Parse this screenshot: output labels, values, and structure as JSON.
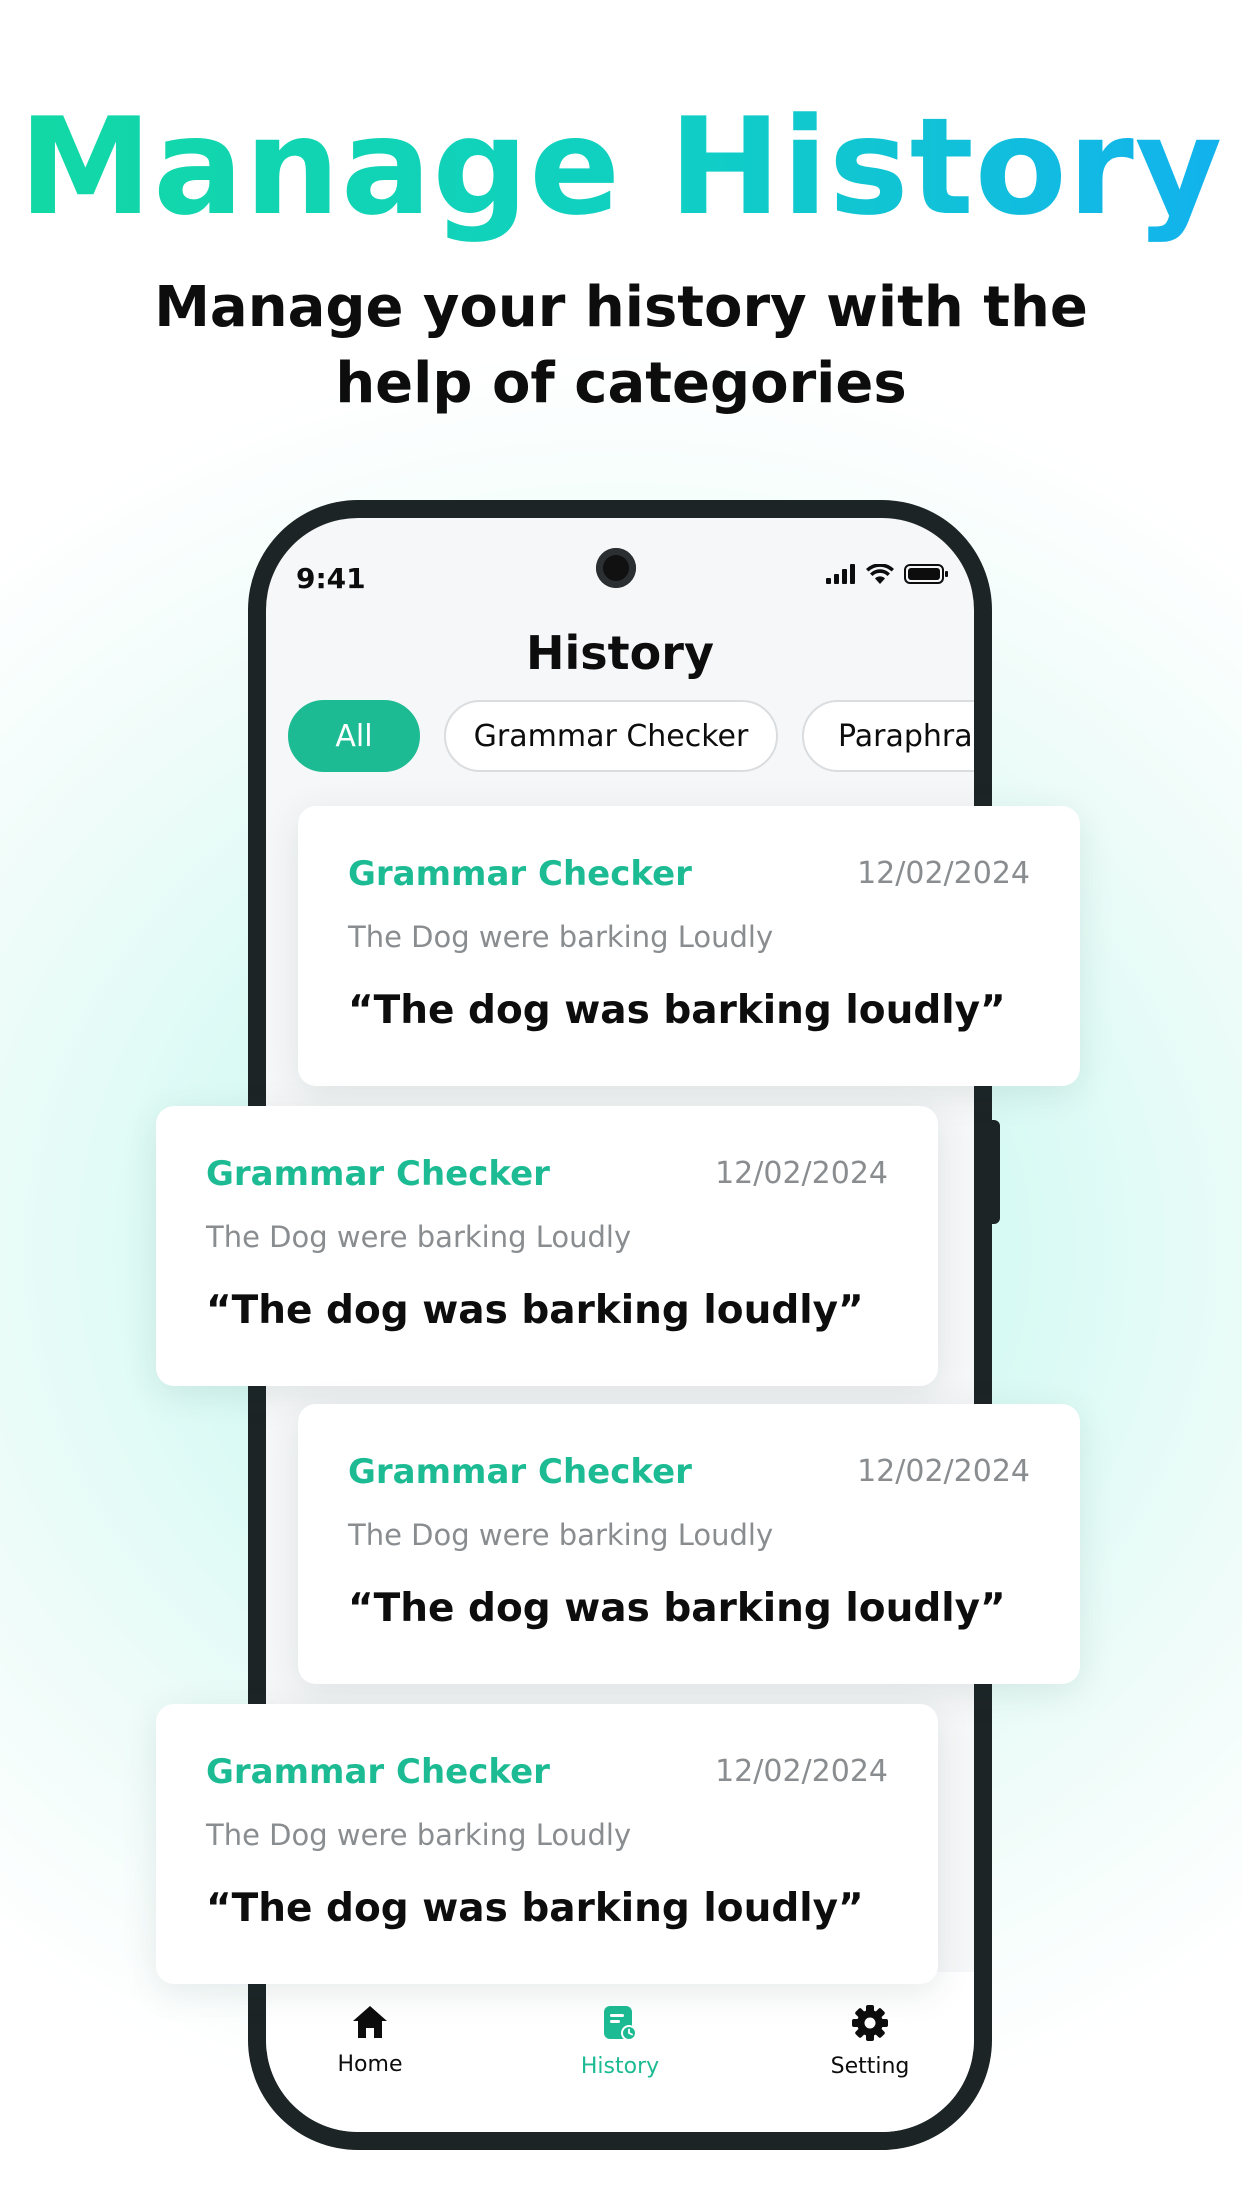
{
  "promo": {
    "headline": "Manage History",
    "subheadline": "Manage your history with the help of categories"
  },
  "status_bar": {
    "time": "9:41"
  },
  "screen": {
    "title": "History",
    "filters": [
      {
        "label": "All",
        "selected": true
      },
      {
        "label": "Grammar Checker",
        "selected": false
      },
      {
        "label": "Paraphra",
        "selected": false
      }
    ]
  },
  "history_items": [
    {
      "category": "Grammar Checker",
      "date": "12/02/2024",
      "original": "The Dog were barking Loudly",
      "corrected": "“The dog was barking loudly”"
    },
    {
      "category": "Grammar Checker",
      "date": "12/02/2024",
      "original": "The Dog were barking Loudly",
      "corrected": "“The dog was barking loudly”"
    },
    {
      "category": "Grammar Checker",
      "date": "12/02/2024",
      "original": "The Dog were barking Loudly",
      "corrected": "“The dog was barking loudly”"
    },
    {
      "category": "Grammar Checker",
      "date": "12/02/2024",
      "original": "The Dog were barking Loudly",
      "corrected": "“The dog was barking loudly”"
    }
  ],
  "bottom_nav": [
    {
      "label": "Home",
      "icon": "home-icon",
      "active": false
    },
    {
      "label": "History",
      "icon": "history-icon",
      "active": true
    },
    {
      "label": "Setting",
      "icon": "gear-icon",
      "active": false
    }
  ],
  "colors": {
    "accent": "#1dbb93",
    "headline_gradient_start": "#12d8a5",
    "headline_gradient_end": "#12b2ee"
  }
}
